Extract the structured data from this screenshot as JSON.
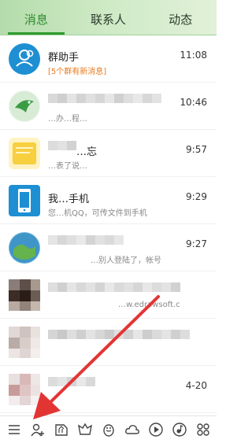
{
  "tabs": [
    {
      "label": "消息"
    },
    {
      "label": "联系人"
    },
    {
      "label": "动态"
    }
  ],
  "conversations": [
    {
      "name": "群助手",
      "preview": "[5个群有新消息]",
      "time": "11:08"
    },
    {
      "name": "",
      "preview": "…办…程…",
      "time": "10:46"
    },
    {
      "name": "…忘",
      "preview": "…表了说…",
      "time": "9:57"
    },
    {
      "name": "我…手机",
      "preview": "您…机QQ，可传文件到手机",
      "time": "9:29"
    },
    {
      "name": "",
      "preview": "…别人登陆了，帐号",
      "time": "9:27"
    },
    {
      "name": "",
      "preview": "…w.edrawsoft.c",
      "time": ""
    },
    {
      "name": "",
      "preview": "…",
      "time": ""
    },
    {
      "name": "",
      "preview": "…",
      "time": "4-20"
    }
  ],
  "bottom_icons": [
    "menu-icon",
    "add-contact-icon",
    "file-share-icon",
    "face-icon",
    "penguin-icon",
    "cloud-icon",
    "play-icon",
    "music-icon",
    "apps-icon"
  ],
  "colors": {
    "accent": "#2f9a2f",
    "alert": "#e8791e",
    "arrow": "#e33434"
  }
}
